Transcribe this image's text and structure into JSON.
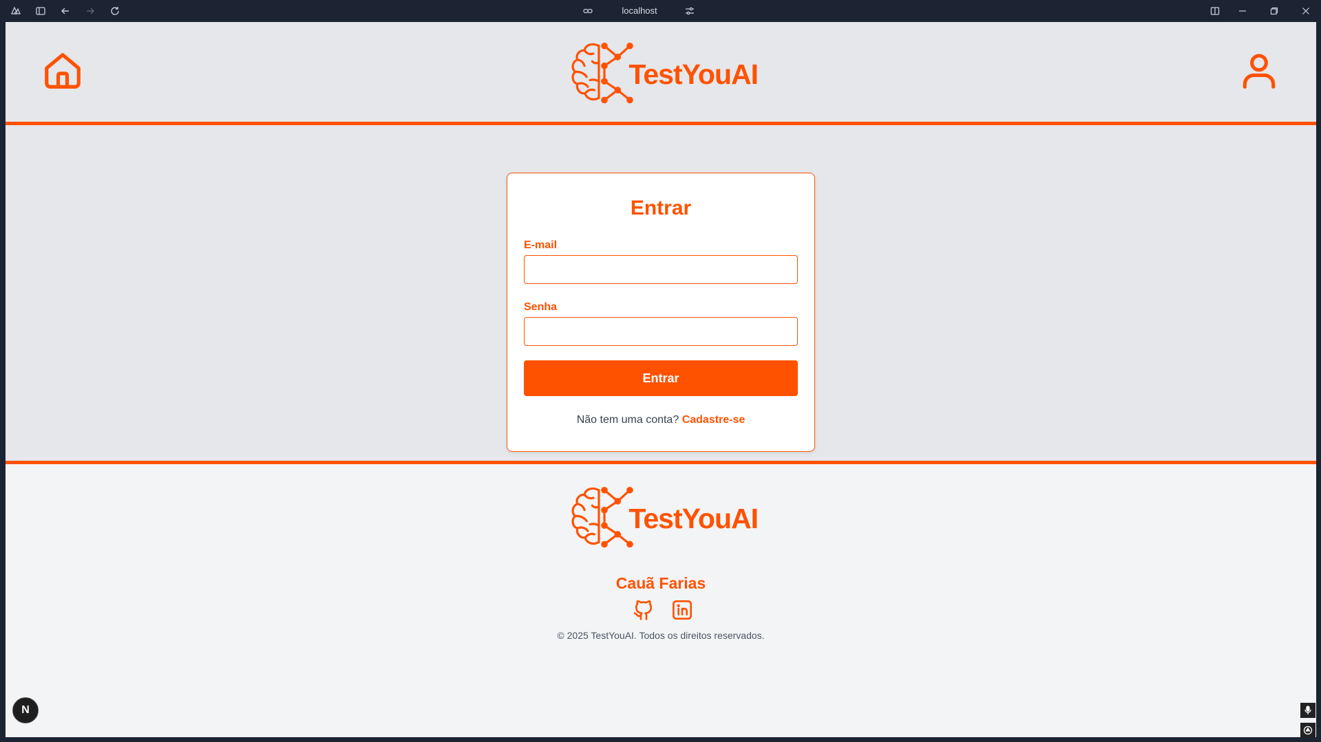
{
  "browser": {
    "url": "localhost",
    "icons": [
      "extensions-icon",
      "sidebar-toggle-icon",
      "back-icon",
      "forward-icon",
      "reload-icon",
      "link-icon",
      "tune-icon",
      "split-view-icon",
      "minimize-icon",
      "restore-icon",
      "close-icon"
    ]
  },
  "header": {
    "brand": "TestYouAI",
    "home_icon": "home-icon",
    "user_icon": "user-icon"
  },
  "login": {
    "title": "Entrar",
    "email_label": "E-mail",
    "email_value": "",
    "password_label": "Senha",
    "password_value": "",
    "submit_label": "Entrar",
    "signup_prompt": "Não tem uma conta?",
    "signup_link": "Cadastre-se"
  },
  "footer": {
    "brand": "TestYouAI",
    "author": "Cauã Farias",
    "social_icons": [
      "github-icon",
      "linkedin-icon"
    ],
    "copyright": "© 2025 TestYouAI. Todos os direitos reservados."
  },
  "widgets": {
    "next_badge": "N"
  },
  "colors": {
    "accent": "#ff5200",
    "page_bg": "#e5e7eb",
    "footer_bg": "#f3f4f6",
    "chrome_bg": "#1c2333"
  }
}
